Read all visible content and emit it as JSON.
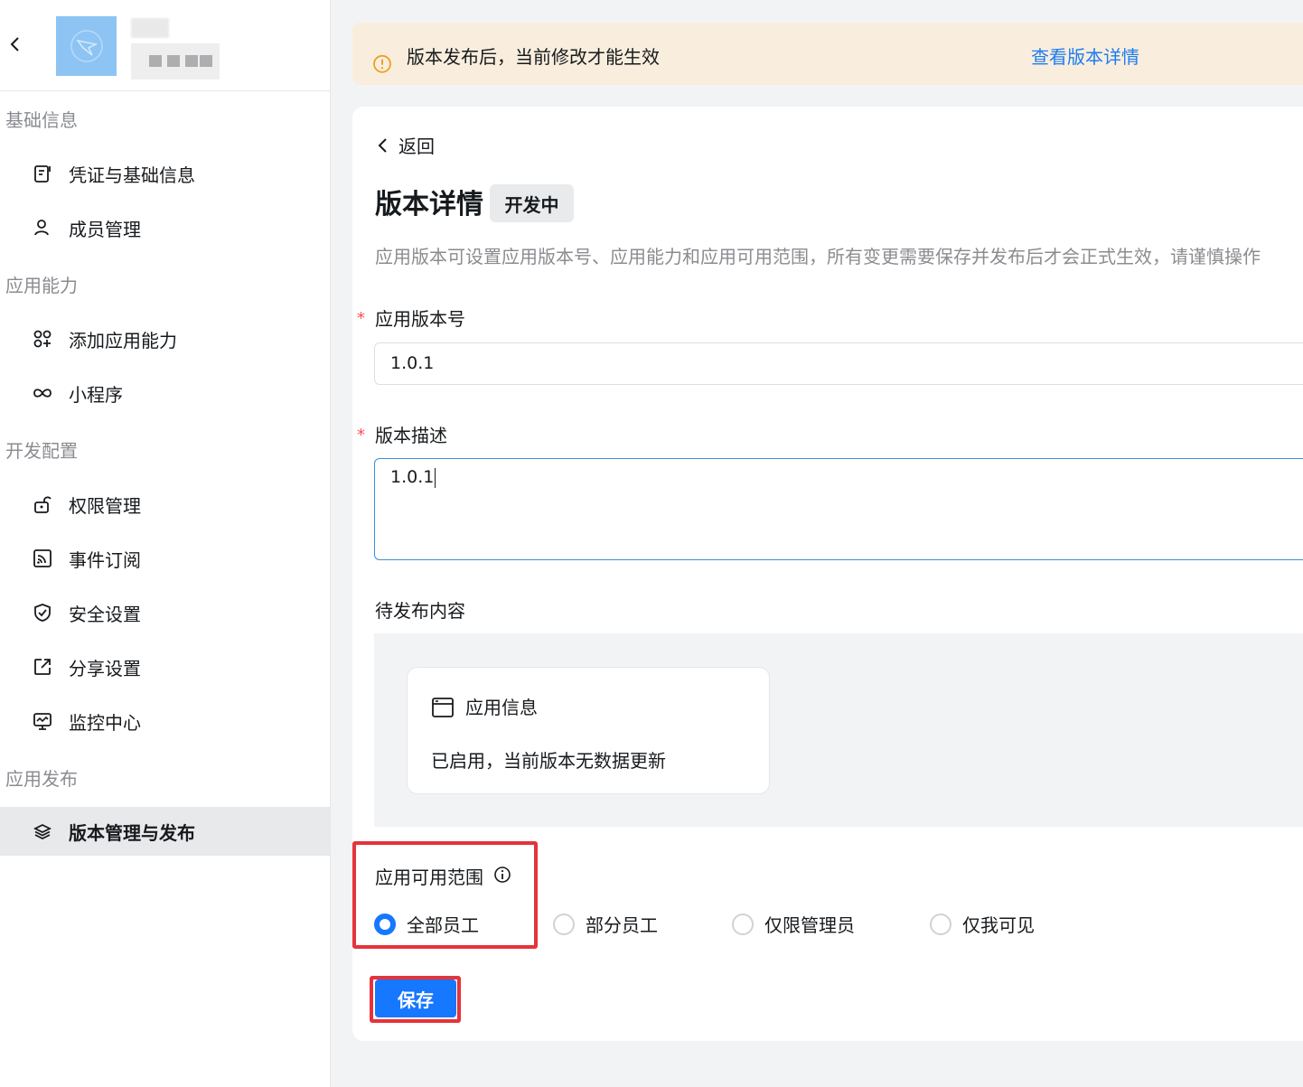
{
  "sidebar": {
    "groups": [
      {
        "label": "基础信息"
      },
      {
        "label": "应用能力"
      },
      {
        "label": "开发配置"
      },
      {
        "label": "应用发布"
      }
    ],
    "items": [
      {
        "label": "凭证与基础信息",
        "icon": "credential-icon"
      },
      {
        "label": "成员管理",
        "icon": "user-icon"
      },
      {
        "label": "添加应用能力",
        "icon": "apps-add-icon"
      },
      {
        "label": "小程序",
        "icon": "infinity-icon"
      },
      {
        "label": "权限管理",
        "icon": "unlock-icon"
      },
      {
        "label": "事件订阅",
        "icon": "rss-icon"
      },
      {
        "label": "安全设置",
        "icon": "shield-check-icon"
      },
      {
        "label": "分享设置",
        "icon": "share-icon"
      },
      {
        "label": "监控中心",
        "icon": "monitor-icon"
      },
      {
        "label": "版本管理与发布",
        "icon": "layers-icon",
        "active": true
      }
    ]
  },
  "notice": {
    "text": "版本发布后，当前修改才能生效",
    "link": "查看版本详情"
  },
  "main": {
    "back_label": "返回",
    "title": "版本详情",
    "status": "开发中",
    "description": "应用版本可设置应用版本号、应用能力和应用可用范围，所有变更需要保存并发布后才会正式生效，请谨慎操作",
    "version_label": "应用版本号",
    "version_value": "1.0.1",
    "desc_label": "版本描述",
    "desc_value": "1.0.1",
    "required_mark": "*",
    "pending_label": "待发布内容",
    "pending_card": {
      "title": "应用信息",
      "subtitle": "已启用，当前版本无数据更新"
    },
    "scope_label": "应用可用范围",
    "scope_options": [
      {
        "label": "全部员工",
        "selected": true
      },
      {
        "label": "部分员工",
        "selected": false
      },
      {
        "label": "仅限管理员",
        "selected": false
      },
      {
        "label": "仅我可见",
        "selected": false
      }
    ],
    "save_label": "保存"
  },
  "colors": {
    "accent": "#1677ff",
    "link": "#1d7cf2",
    "notice_bg": "#f9eedd",
    "notice_icon": "#f0a020",
    "highlight": "#e5333a",
    "required": "#ff4d4f"
  }
}
